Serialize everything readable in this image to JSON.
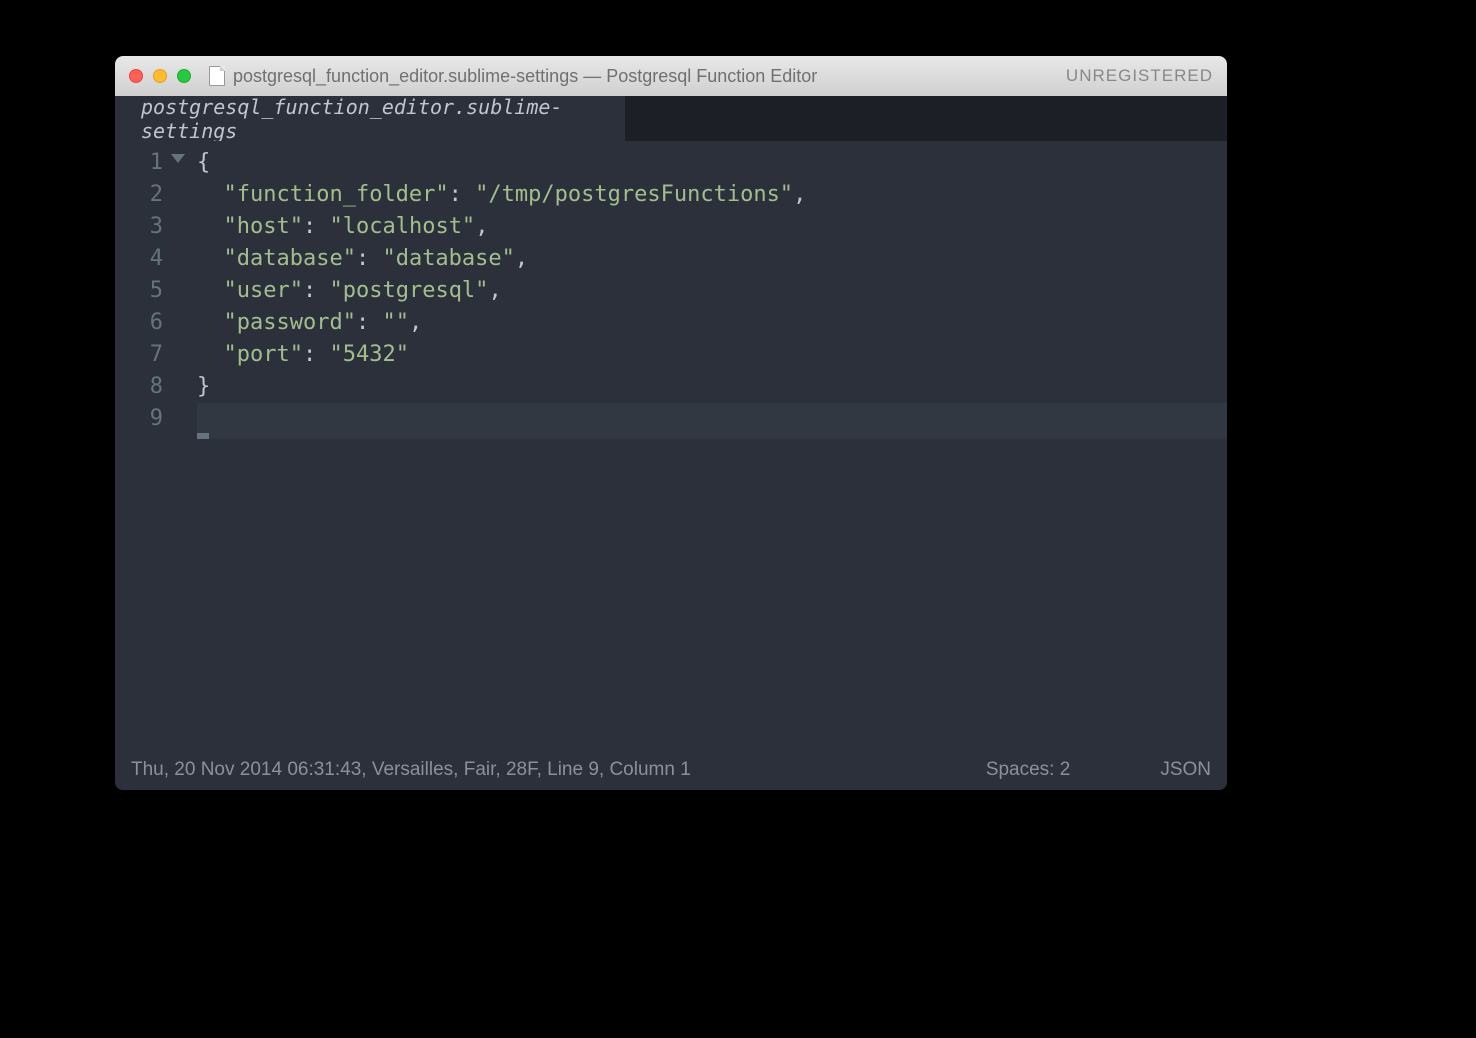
{
  "title": "postgresql_function_editor.sublime-settings — Postgresql Function Editor",
  "badge": "UNREGISTERED",
  "tab": {
    "label": "postgresql_function_editor.sublime-settings"
  },
  "code": {
    "lines": [
      {
        "n": "1",
        "tokens": [
          {
            "t": "punct",
            "s": "{"
          }
        ],
        "fold": true
      },
      {
        "n": "2",
        "tokens": [
          {
            "t": "plain",
            "s": "  "
          },
          {
            "t": "key",
            "s": "\"function_folder\""
          },
          {
            "t": "punct",
            "s": ": "
          },
          {
            "t": "string",
            "s": "\"/tmp/postgresFunctions\""
          },
          {
            "t": "punct",
            "s": ","
          }
        ]
      },
      {
        "n": "3",
        "tokens": [
          {
            "t": "plain",
            "s": "  "
          },
          {
            "t": "key",
            "s": "\"host\""
          },
          {
            "t": "punct",
            "s": ": "
          },
          {
            "t": "string",
            "s": "\"localhost\""
          },
          {
            "t": "punct",
            "s": ","
          }
        ]
      },
      {
        "n": "4",
        "tokens": [
          {
            "t": "plain",
            "s": "  "
          },
          {
            "t": "key",
            "s": "\"database\""
          },
          {
            "t": "punct",
            "s": ": "
          },
          {
            "t": "string",
            "s": "\"database\""
          },
          {
            "t": "punct",
            "s": ","
          }
        ]
      },
      {
        "n": "5",
        "tokens": [
          {
            "t": "plain",
            "s": "  "
          },
          {
            "t": "key",
            "s": "\"user\""
          },
          {
            "t": "punct",
            "s": ": "
          },
          {
            "t": "string",
            "s": "\"postgresql\""
          },
          {
            "t": "punct",
            "s": ","
          }
        ]
      },
      {
        "n": "6",
        "tokens": [
          {
            "t": "plain",
            "s": "  "
          },
          {
            "t": "key",
            "s": "\"password\""
          },
          {
            "t": "punct",
            "s": ": "
          },
          {
            "t": "string",
            "s": "\"\""
          },
          {
            "t": "punct",
            "s": ","
          }
        ]
      },
      {
        "n": "7",
        "tokens": [
          {
            "t": "plain",
            "s": "  "
          },
          {
            "t": "key",
            "s": "\"port\""
          },
          {
            "t": "punct",
            "s": ": "
          },
          {
            "t": "string",
            "s": "\"5432\""
          }
        ]
      },
      {
        "n": "8",
        "tokens": [
          {
            "t": "punct",
            "s": "}"
          }
        ]
      },
      {
        "n": "9",
        "tokens": [],
        "cursor": true
      }
    ]
  },
  "status": {
    "left": "Thu, 20 Nov 2014 06:31:43, Versailles, Fair, 28F, Line 9, Column 1",
    "spaces": "Spaces: 2",
    "syntax": "JSON"
  }
}
